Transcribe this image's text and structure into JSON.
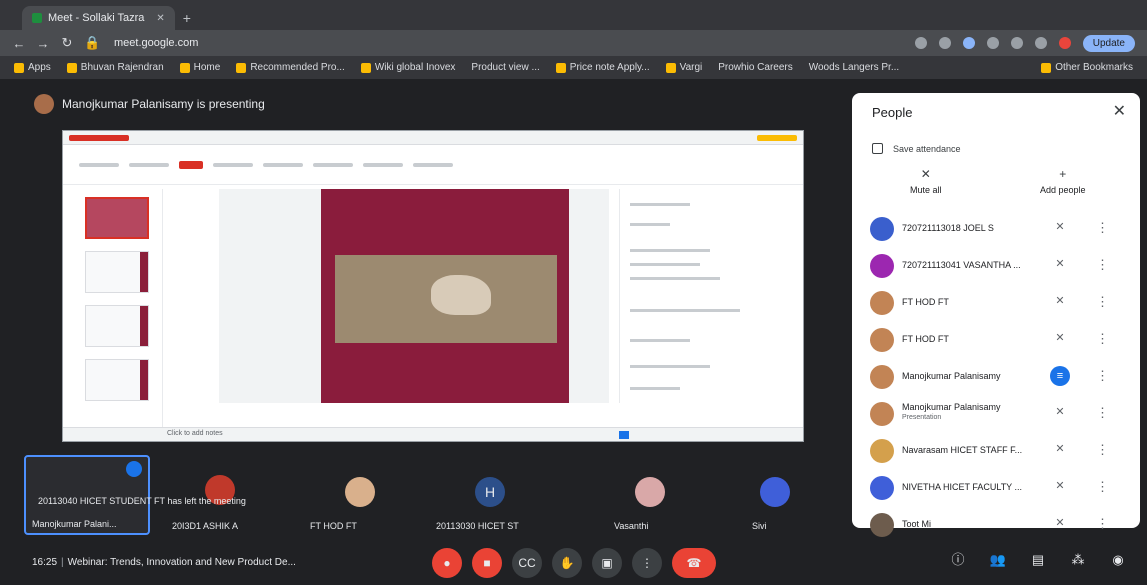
{
  "browser": {
    "tab_title": "Meet - Sollaki Tazra",
    "url": "meet.google.com",
    "update_label": "Update",
    "bookmarks": [
      "Apps",
      "Bhuvan Rajendran",
      "Home",
      "Recommended Pro...",
      "Wiki global Inovex",
      "Product view ...",
      "Price note Apply...",
      "Vargi",
      "Prowhio Careers",
      "Woods Langers Pr..."
    ],
    "other_bookmarks": "Other Bookmarks"
  },
  "meet": {
    "presenting_text": "Manojkumar Palanisamy is presenting",
    "slide_footer": "Click to add notes",
    "tiles": [
      {
        "label": "Manojkumar Palani...",
        "color": "#2b2c30"
      },
      {
        "label": "20I3D1 ASHIK A",
        "color": "#c0392b"
      },
      {
        "label": "FT HOD FT",
        "color": "#d9b08c"
      },
      {
        "label": "20113030 HICET ST",
        "color": "#2c4f8a",
        "initial": "H"
      },
      {
        "label": "Vasanthi",
        "color": "#d9a8a8"
      },
      {
        "label": "Sivi",
        "color": "#3f5fd9"
      }
    ],
    "toast": "20113040 HICET STUDENT FT has left the meeting",
    "meeting_time": "16:25",
    "meeting_title": "Webinar: Trends, Innovation and New Product De..."
  },
  "people_panel": {
    "title": "People",
    "save_attendance": "Save attendance",
    "mute_all": "Mute all",
    "add_people": "Add people",
    "participants": [
      {
        "name": "720721113018 JOEL S",
        "sub": "",
        "color": "#3a5fcd",
        "mic": "off"
      },
      {
        "name": "720721113041 VASANTHA ...",
        "sub": "",
        "color": "#9c27b0",
        "mic": "off"
      },
      {
        "name": "FT HOD FT",
        "sub": "",
        "color": "#c28455",
        "mic": "off"
      },
      {
        "name": "FT HOD FT",
        "sub": "",
        "color": "#c28455",
        "mic": "off"
      },
      {
        "name": "Manojkumar Palanisamy",
        "sub": "",
        "color": "#c28455",
        "mic": "on"
      },
      {
        "name": "Manojkumar Palanisamy",
        "sub": "Presentation",
        "color": "#c28455",
        "mic": "off"
      },
      {
        "name": "Navarasam HICET STAFF F...",
        "sub": "",
        "color": "#d4a04c",
        "mic": "off"
      },
      {
        "name": "NIVETHA HICET FACULTY ...",
        "sub": "",
        "color": "#3f5fd9",
        "mic": "off"
      },
      {
        "name": "Toot Mi",
        "sub": "",
        "color": "#6d5c4d",
        "mic": "off"
      }
    ]
  }
}
